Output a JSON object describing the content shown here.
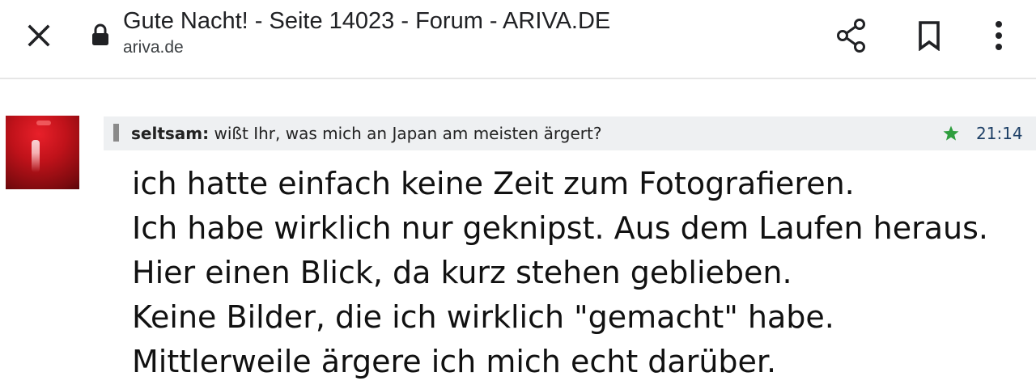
{
  "browser": {
    "title": "Gute Nacht! - Seite 14023 - Forum - ARIVA.DE",
    "domain": "ariva.de"
  },
  "icons": {
    "close": "close-icon",
    "lock": "lock-icon",
    "share": "share-icon",
    "bookmark": "bookmark-icon",
    "more": "more-vert-icon",
    "star": "star-icon"
  },
  "post": {
    "quote": {
      "author": "seltsam:",
      "text": " wißt Ihr, was mich an Japan am meisten ärgert?"
    },
    "time": "21:14",
    "lines": [
      "ich hatte einfach keine Zeit zum Fotografieren.",
      "Ich habe wirklich nur geknipst. Aus dem Laufen heraus.",
      "Hier einen Blick, da kurz stehen geblieben.",
      "Keine Bilder, die ich wirklich \"gemacht\" habe.",
      "Mittlerweile ärgere ich mich echt darüber."
    ]
  },
  "colors": {
    "star": "#2e9e3e",
    "time": "#1d3f66",
    "quote_bg": "#eef0f2",
    "avatar": "#c0121a"
  }
}
